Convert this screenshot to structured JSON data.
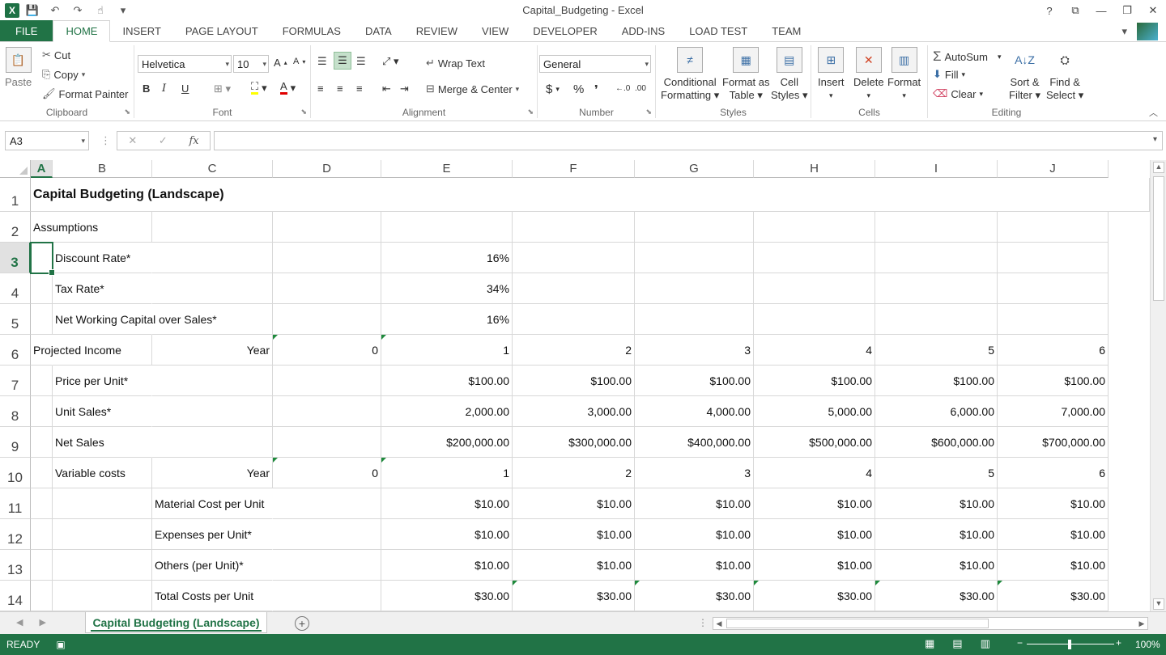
{
  "window": {
    "title": "Capital_Budgeting - Excel",
    "help": "?",
    "controls": {
      "ribbon_display": "⧉",
      "minimize": "—",
      "restore": "❐",
      "close": "✕"
    }
  },
  "qat": {
    "save": "💾",
    "undo": "↶",
    "redo": "↷",
    "touch": "☝",
    "more": "▾"
  },
  "tabs": {
    "file": "FILE",
    "items": [
      "HOME",
      "INSERT",
      "PAGE LAYOUT",
      "FORMULAS",
      "DATA",
      "REVIEW",
      "VIEW",
      "DEVELOPER",
      "ADD-INS",
      "LOAD TEST",
      "TEAM"
    ],
    "active": "HOME"
  },
  "ribbon": {
    "clipboard": {
      "label": "Clipboard",
      "paste": "Paste",
      "cut": "Cut",
      "copy": "Copy",
      "format_painter": "Format Painter"
    },
    "font": {
      "label": "Font",
      "font_name": "Helvetica",
      "font_size": "10",
      "bold": "B",
      "italic": "I",
      "underline": "U"
    },
    "alignment": {
      "label": "Alignment",
      "wrap_text": "Wrap Text",
      "merge_center": "Merge & Center"
    },
    "number": {
      "label": "Number",
      "format": "General",
      "currency": "$",
      "percent": "%",
      "comma": "❜"
    },
    "styles": {
      "label": "Styles",
      "conditional": "Conditional",
      "conditional2": "Formatting",
      "format_as": "Format as",
      "format_as2": "Table",
      "cell": "Cell",
      "cell2": "Styles"
    },
    "cells": {
      "label": "Cells",
      "insert": "Insert",
      "delete": "Delete",
      "format": "Format"
    },
    "editing": {
      "label": "Editing",
      "autosum": "AutoSum",
      "fill": "Fill",
      "clear": "Clear",
      "sort": "Sort &",
      "sort2": "Filter",
      "find": "Find &",
      "find2": "Select"
    }
  },
  "formula_bar": {
    "name_box": "A3",
    "formula": "",
    "fx": "fx"
  },
  "columns": [
    "A",
    "B",
    "C",
    "D",
    "E",
    "F",
    "G",
    "H",
    "I",
    "J"
  ],
  "selected_column": "A",
  "rows": [
    "1",
    "2",
    "3",
    "4",
    "5",
    "6",
    "7",
    "8",
    "9",
    "10",
    "11",
    "12",
    "13",
    "14"
  ],
  "selected_row": "3",
  "cells": {
    "r1": {
      "title": "Capital Budgeting (Landscape)"
    },
    "r2": {
      "a": "Assumptions"
    },
    "r3": {
      "b": "Discount Rate*",
      "e": "16%"
    },
    "r4": {
      "b": "Tax Rate*",
      "e": "34%"
    },
    "r5": {
      "b": "Net Working Capital over Sales*",
      "e": "16%"
    },
    "r6": {
      "a": "Projected Income",
      "c": "Year",
      "d": "0",
      "e": "1",
      "f": "2",
      "g": "3",
      "h": "4",
      "i": "5",
      "j": "6"
    },
    "r7": {
      "b": "Price per Unit*",
      "e": "$100.00",
      "f": "$100.00",
      "g": "$100.00",
      "h": "$100.00",
      "i": "$100.00",
      "j": "$100.00"
    },
    "r8": {
      "b": "Unit Sales*",
      "e": "2,000.00",
      "f": "3,000.00",
      "g": "4,000.00",
      "h": "5,000.00",
      "i": "6,000.00",
      "j": "7,000.00"
    },
    "r9": {
      "b": "Net Sales",
      "e": "$200,000.00",
      "f": "$300,000.00",
      "g": "$400,000.00",
      "h": "$500,000.00",
      "i": "$600,000.00",
      "j": "$700,000.00"
    },
    "r10": {
      "b": "Variable costs",
      "c": "Year",
      "d": "0",
      "e": "1",
      "f": "2",
      "g": "3",
      "h": "4",
      "i": "5",
      "j": "6"
    },
    "r11": {
      "c": "Material Cost per Unit",
      "e": "$10.00",
      "f": "$10.00",
      "g": "$10.00",
      "h": "$10.00",
      "i": "$10.00",
      "j": "$10.00"
    },
    "r12": {
      "c": "Expenses per Unit*",
      "e": "$10.00",
      "f": "$10.00",
      "g": "$10.00",
      "h": "$10.00",
      "i": "$10.00",
      "j": "$10.00"
    },
    "r13": {
      "c": "Others (per Unit)*",
      "e": "$10.00",
      "f": "$10.00",
      "g": "$10.00",
      "h": "$10.00",
      "i": "$10.00",
      "j": "$10.00"
    },
    "r14": {
      "c": "Total Costs per Unit",
      "e": "$30.00",
      "f": "$30.00",
      "g": "$30.00",
      "h": "$30.00",
      "i": "$30.00",
      "j": "$30.00"
    }
  },
  "sheets": {
    "active": "Capital Budgeting (Landscape)",
    "add": "+"
  },
  "status": {
    "mode": "READY",
    "zoom": "100%",
    "minus": "−",
    "plus": "+"
  },
  "colors": {
    "accent": "#217346",
    "error_indicator": "#1e8a3c"
  }
}
